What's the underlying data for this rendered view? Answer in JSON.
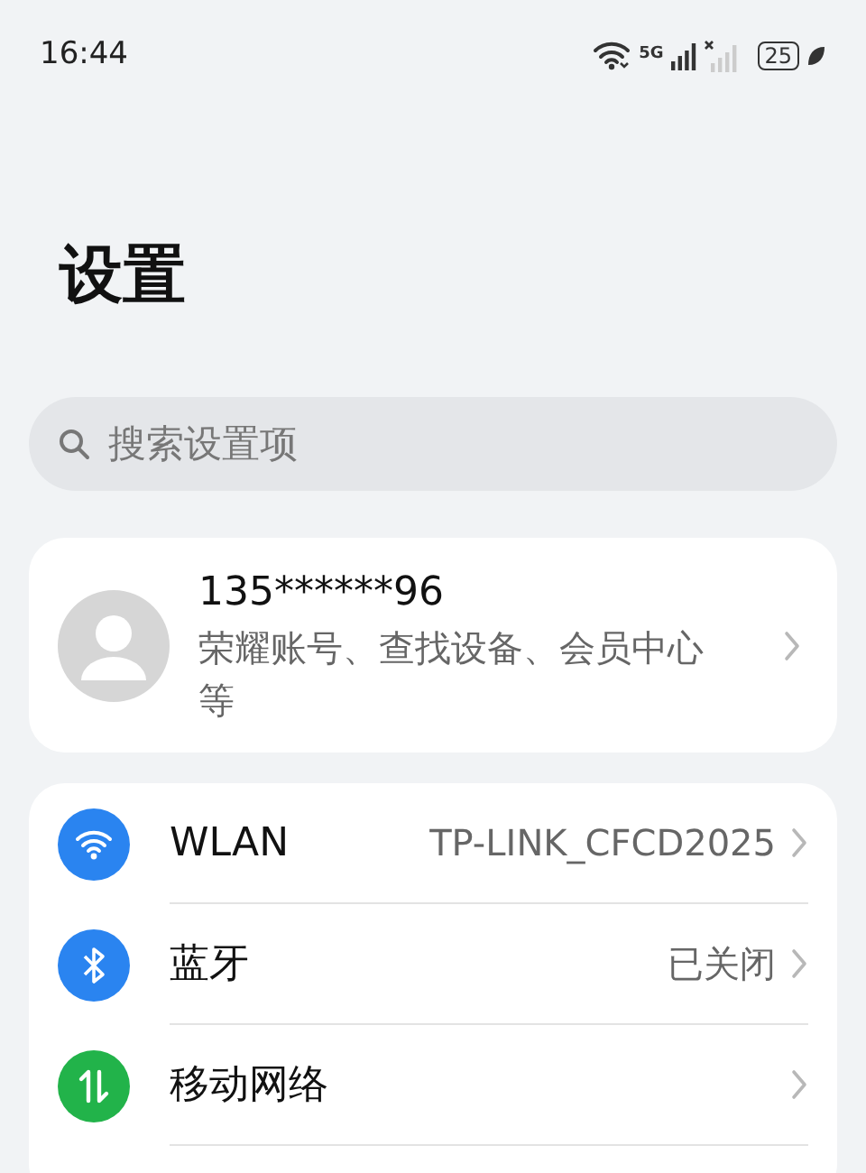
{
  "status_bar": {
    "time": "16:44",
    "network_label": "5G",
    "battery": "25"
  },
  "title": "设置",
  "search": {
    "placeholder": "搜索设置项"
  },
  "account": {
    "name": "135******96",
    "subtitle": "荣耀账号、查找设备、会员中心等"
  },
  "settings": [
    {
      "label": "WLAN",
      "value": "TP-LINK_CFCD2025",
      "color": "#2a84f0"
    },
    {
      "label": "蓝牙",
      "value": "已关闭",
      "color": "#2a84f0"
    },
    {
      "label": "移动网络",
      "color": "#22b34a"
    }
  ]
}
